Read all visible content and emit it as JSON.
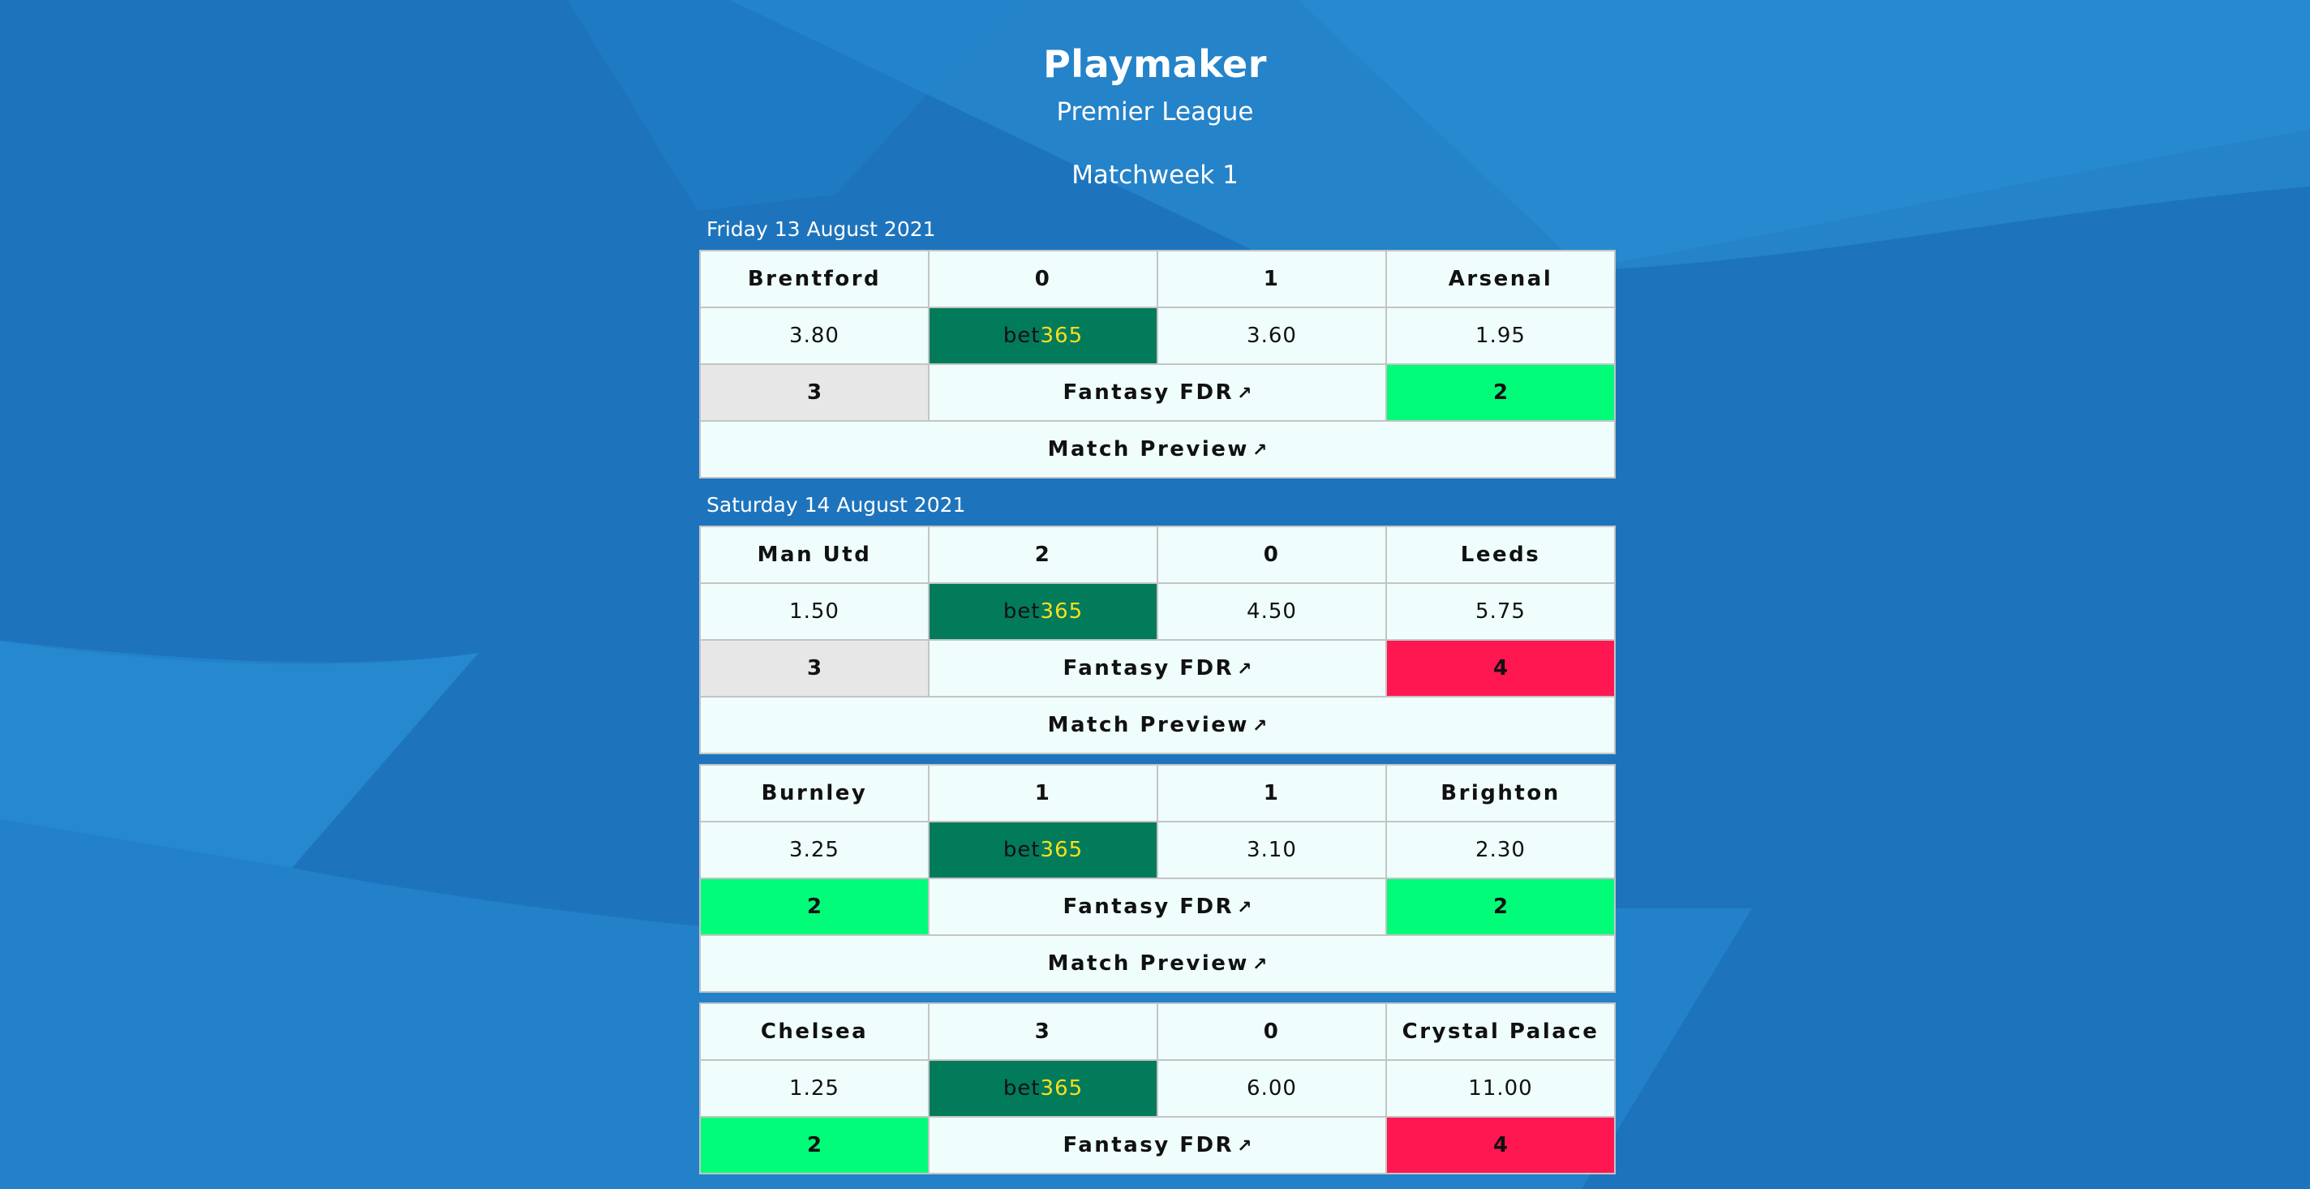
{
  "app": {
    "title": "Playmaker",
    "league": "Premier League",
    "matchweek": "Matchweek 1"
  },
  "colors": {
    "background": "#1d74bd",
    "card": "#effefd",
    "bet365_bg": "#027b5b",
    "bet365_accent": "#ffdf1b",
    "fdr_2": "#01fc7a",
    "fdr_3": "#e7e7e7",
    "fdr_4": "#ff1751",
    "link": "#3a6fd6"
  },
  "labels": {
    "bet_brand": "bet",
    "bet_num": "365",
    "fantasy_fdr": "Fantasy FDR",
    "match_preview": "Match Preview",
    "external_icon": "external-link-icon",
    "arrow_glyph": "↗"
  },
  "days": [
    {
      "date": "Friday 13 August 2021",
      "matches": [
        {
          "home": "Brentford",
          "home_score": "0",
          "away_score": "1",
          "away": "Arsenal",
          "home_odds": "3.80",
          "draw_odds": "3.60",
          "away_odds": "1.95",
          "home_fdr": "3",
          "away_fdr": "2"
        }
      ]
    },
    {
      "date": "Saturday 14 August 2021",
      "matches": [
        {
          "home": "Man Utd",
          "home_score": "2",
          "away_score": "0",
          "away": "Leeds",
          "home_odds": "1.50",
          "draw_odds": "4.50",
          "away_odds": "5.75",
          "home_fdr": "3",
          "away_fdr": "4"
        },
        {
          "home": "Burnley",
          "home_score": "1",
          "away_score": "1",
          "away": "Brighton",
          "home_odds": "3.25",
          "draw_odds": "3.10",
          "away_odds": "2.30",
          "home_fdr": "2",
          "away_fdr": "2"
        },
        {
          "home": "Chelsea",
          "home_score": "3",
          "away_score": "0",
          "away": "Crystal Palace",
          "home_odds": "1.25",
          "draw_odds": "6.00",
          "away_odds": "11.00",
          "home_fdr": "2",
          "away_fdr": "4"
        }
      ]
    }
  ]
}
